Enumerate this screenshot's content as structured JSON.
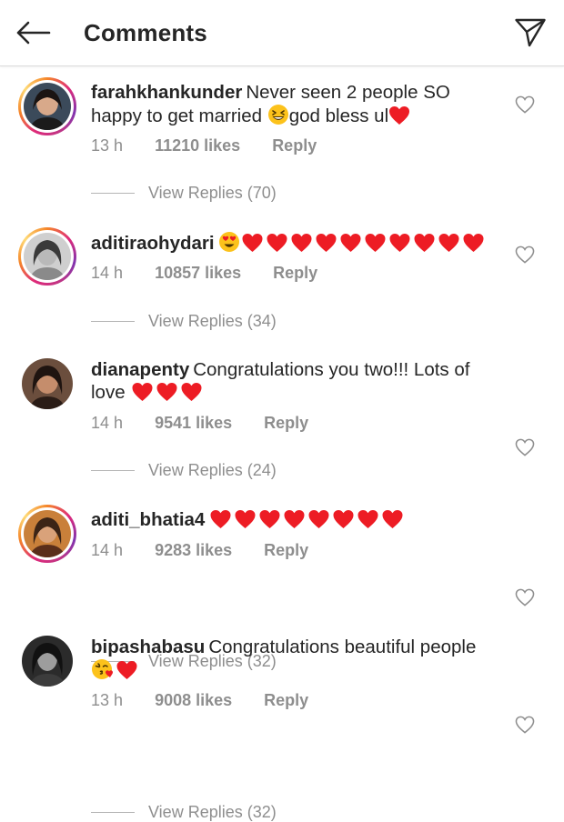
{
  "header": {
    "title": "Comments",
    "back_icon": "arrow-left-icon",
    "send_icon": "paper-plane-icon"
  },
  "colors": {
    "text": "#262626",
    "secondary": "#8e8e8e",
    "heart": "#ed1c24",
    "story_ring": [
      "#feda77",
      "#f58529",
      "#dd2a7b",
      "#8134af"
    ]
  },
  "comments": [
    {
      "username": "farahkhankunder",
      "text_part1": "Never seen 2 people SO happy to get married ",
      "emoji_mid": "grinning-squinting-face",
      "text_part2": "god bless ul",
      "emoji_end": "red-heart",
      "time": "13 h",
      "likes": "11210 likes",
      "reply": "Reply",
      "view_replies": "View Replies (70)",
      "has_story_ring": true
    },
    {
      "username": "aditiraohydari",
      "text_part1": "",
      "emojis": [
        "smiling-face-with-heart-eyes",
        "red-heart",
        "red-heart",
        "red-heart",
        "red-heart",
        "red-heart",
        "red-heart",
        "red-heart",
        "red-heart",
        "red-heart",
        "red-heart"
      ],
      "time": "14 h",
      "likes": "10857 likes",
      "reply": "Reply",
      "view_replies": "View Replies (34)",
      "has_story_ring": true
    },
    {
      "username": "dianapenty",
      "text_part1": "Congratulations you two!!! Lots of love ",
      "emojis": [
        "red-heart",
        "red-heart",
        "red-heart"
      ],
      "time": "14 h",
      "likes": "9541 likes",
      "reply": "Reply",
      "view_replies": "View Replies (24)",
      "has_story_ring": false
    },
    {
      "username": "aditi_bhatia4",
      "text_part1": "",
      "emojis": [
        "red-heart",
        "red-heart",
        "red-heart",
        "red-heart",
        "red-heart",
        "red-heart",
        "red-heart",
        "red-heart"
      ],
      "time": "14 h",
      "likes": "9283 likes",
      "reply": "Reply",
      "view_replies": "View Replies (32)",
      "has_story_ring": true
    },
    {
      "username": "bipashabasu",
      "text_part1": "Congratulations beautiful people ",
      "emojis": [
        "face-blowing-a-kiss",
        "red-heart"
      ],
      "time": "13 h",
      "likes": "9008 likes",
      "reply": "Reply",
      "view_replies": "View Replies (32)",
      "has_story_ring": false
    }
  ]
}
